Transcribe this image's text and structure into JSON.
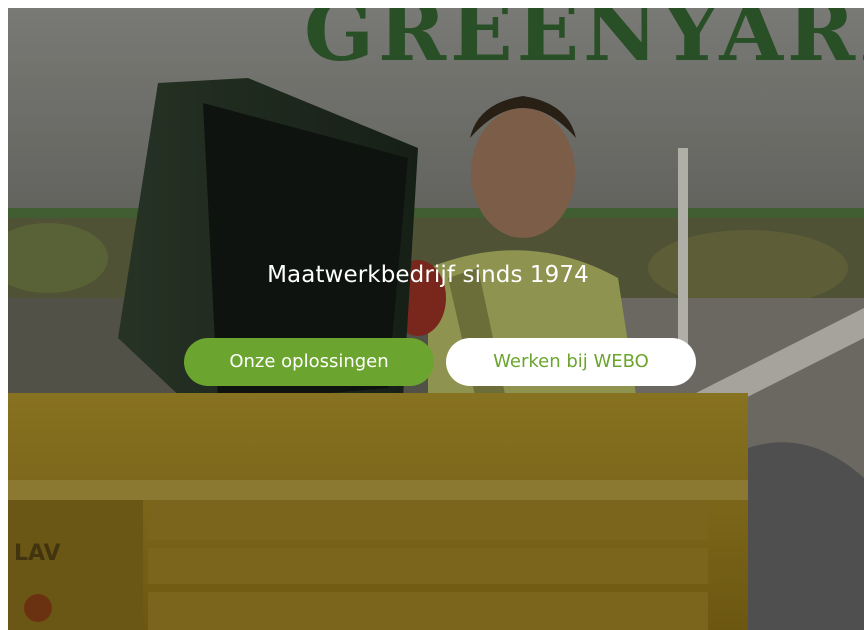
{
  "hero": {
    "tagline": "Maatwerkbedrijf sinds 1974",
    "background_sign_text": "GREENYARD",
    "crate_label": "LAV",
    "buttons": {
      "primary_label": "Onze oplossingen",
      "secondary_label": "Werken bij WEBO"
    }
  },
  "colors": {
    "accent_green": "#6ba52f",
    "white": "#ffffff"
  }
}
